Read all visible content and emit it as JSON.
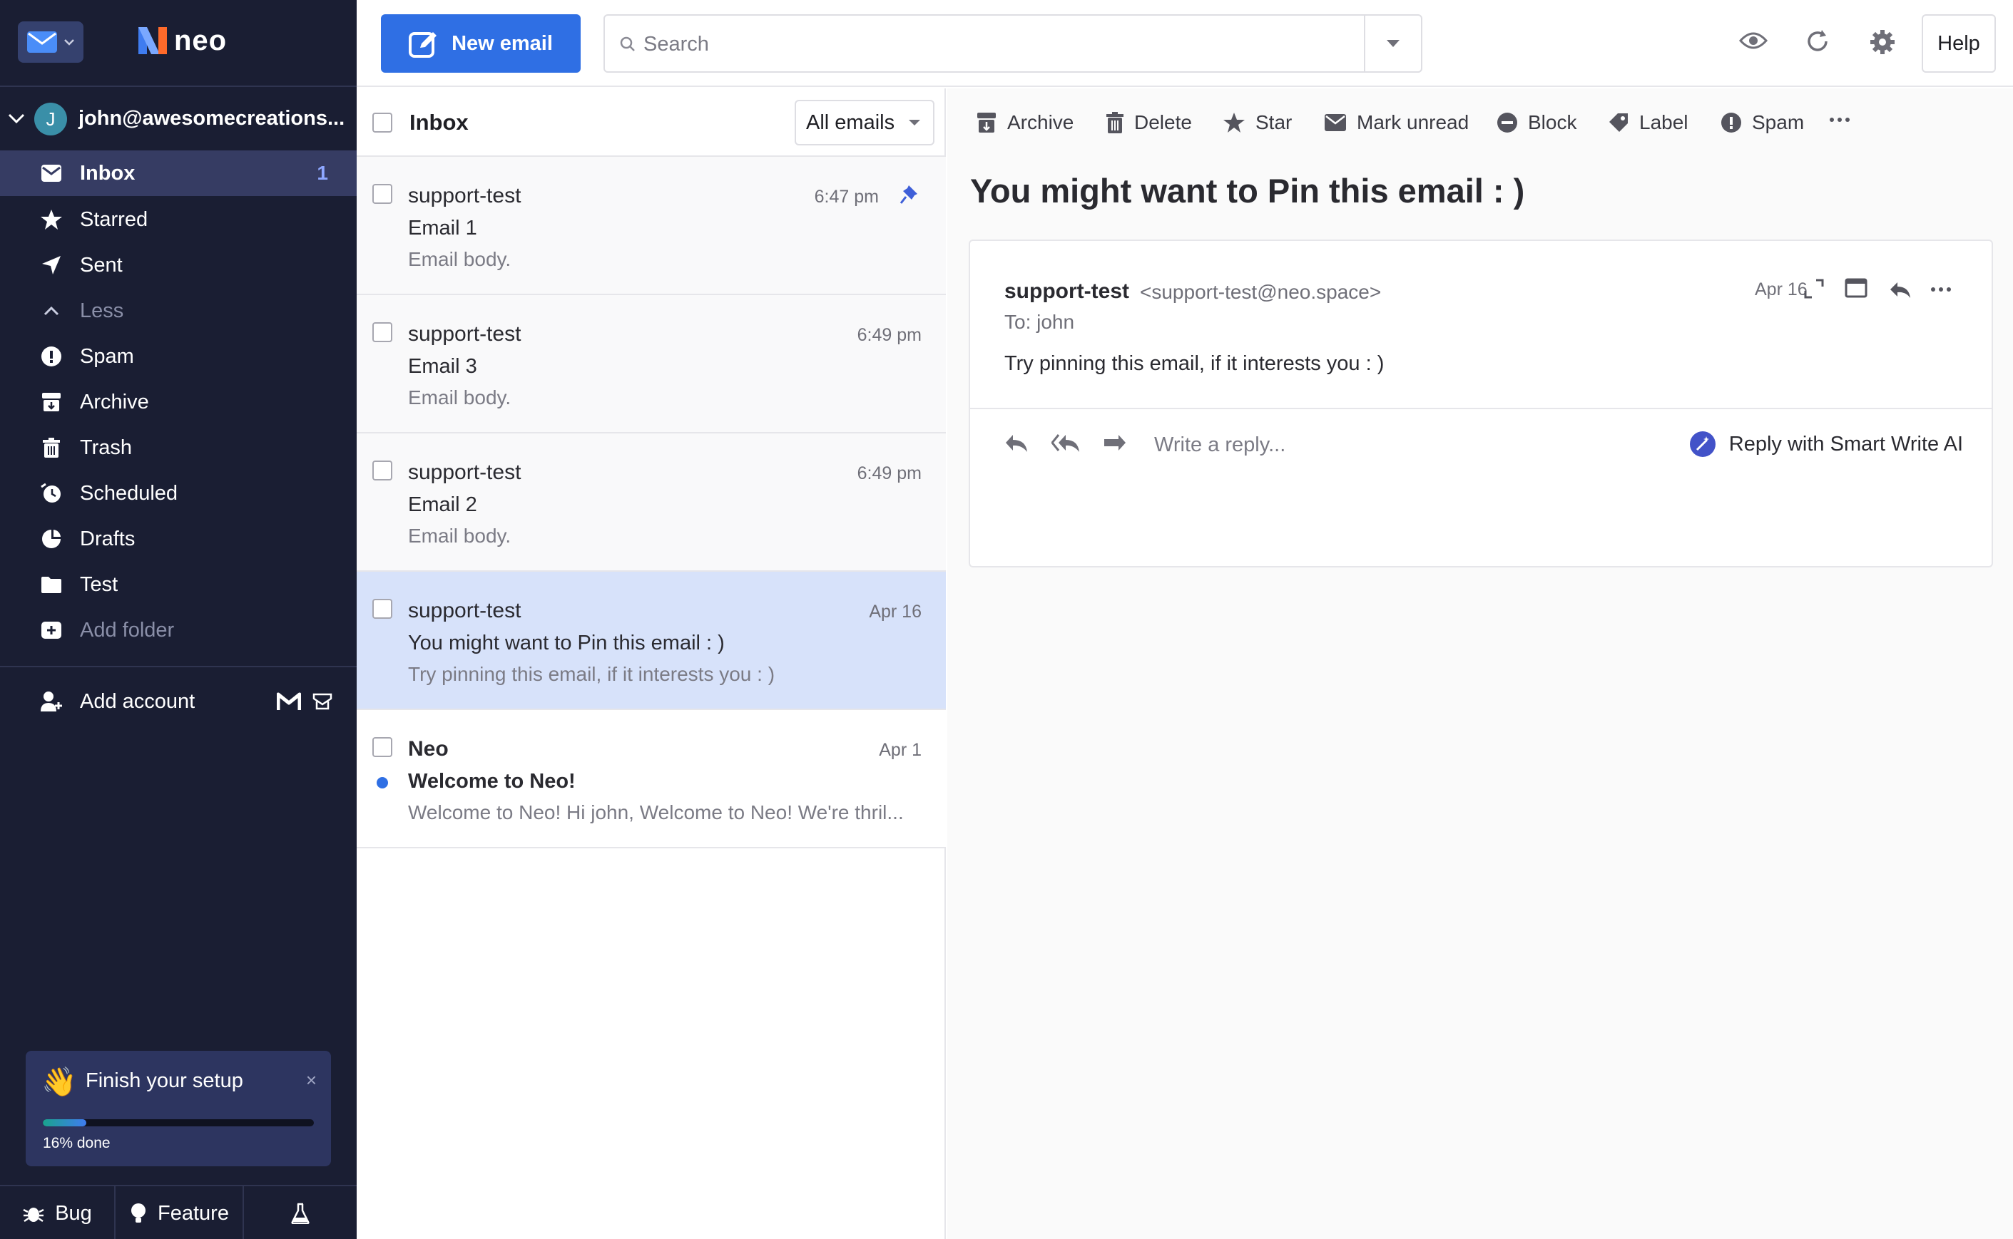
{
  "sidebar": {
    "account_initial": "J",
    "account_email": "john@awesomecreations...",
    "logo_text": "neo",
    "nav": [
      {
        "label": "Inbox",
        "count": "1",
        "icon": "inbox-icon"
      },
      {
        "label": "Starred",
        "icon": "star-icon"
      },
      {
        "label": "Sent",
        "icon": "send-icon"
      },
      {
        "label": "Less",
        "icon": "chevron-up-icon"
      },
      {
        "label": "Spam",
        "icon": "spam-icon"
      },
      {
        "label": "Archive",
        "icon": "archive-icon"
      },
      {
        "label": "Trash",
        "icon": "trash-icon"
      },
      {
        "label": "Scheduled",
        "icon": "clock-icon"
      },
      {
        "label": "Drafts",
        "icon": "drafts-icon"
      },
      {
        "label": "Test",
        "icon": "folder-icon"
      },
      {
        "label": "Add folder",
        "icon": "add-folder-icon"
      }
    ],
    "add_account": "Add account",
    "setup": {
      "title": "Finish your setup",
      "done_label": "16% done",
      "progress": 0.16,
      "close": "×"
    },
    "bottom": {
      "bug": "Bug",
      "feature": "Feature"
    }
  },
  "topbar": {
    "new_email": "New email",
    "search_placeholder": "Search",
    "help": "Help"
  },
  "list": {
    "title": "Inbox",
    "filter": "All emails",
    "emails": [
      {
        "from": "support-test",
        "date": "6:47 pm",
        "subject": "Email 1",
        "preview": "Email body.",
        "pinned": true
      },
      {
        "from": "support-test",
        "date": "6:49 pm",
        "subject": "Email 3",
        "preview": "Email body."
      },
      {
        "from": "support-test",
        "date": "6:49 pm",
        "subject": "Email 2",
        "preview": "Email body."
      },
      {
        "from": "support-test",
        "date": "Apr 16",
        "subject": "You might want to Pin this email : )",
        "preview": "Try pinning this email, if it interests you : )",
        "selected": true
      },
      {
        "from": "Neo",
        "date": "Apr 1",
        "subject": "Welcome to Neo!",
        "preview": "Welcome to Neo! Hi john, Welcome to Neo! We're thril...",
        "unread": true
      }
    ]
  },
  "reader": {
    "toolbar": {
      "archive": "Archive",
      "delete": "Delete",
      "star": "Star",
      "mark_unread": "Mark unread",
      "block": "Block",
      "label": "Label",
      "spam": "Spam"
    },
    "subject": "You might want to Pin this email : )",
    "message": {
      "from_name": "support-test",
      "from_addr": "<support-test@neo.space>",
      "to": "To: john",
      "date": "Apr 16",
      "body": "Try pinning this email, if it interests you : )"
    },
    "reply_placeholder": "Write a reply...",
    "smart_write": "Reply with Smart Write AI"
  },
  "colors": {
    "sidebar_bg": "#1a1e33",
    "accent": "#2f6fe4",
    "selected_row": "#d7e2fa"
  }
}
